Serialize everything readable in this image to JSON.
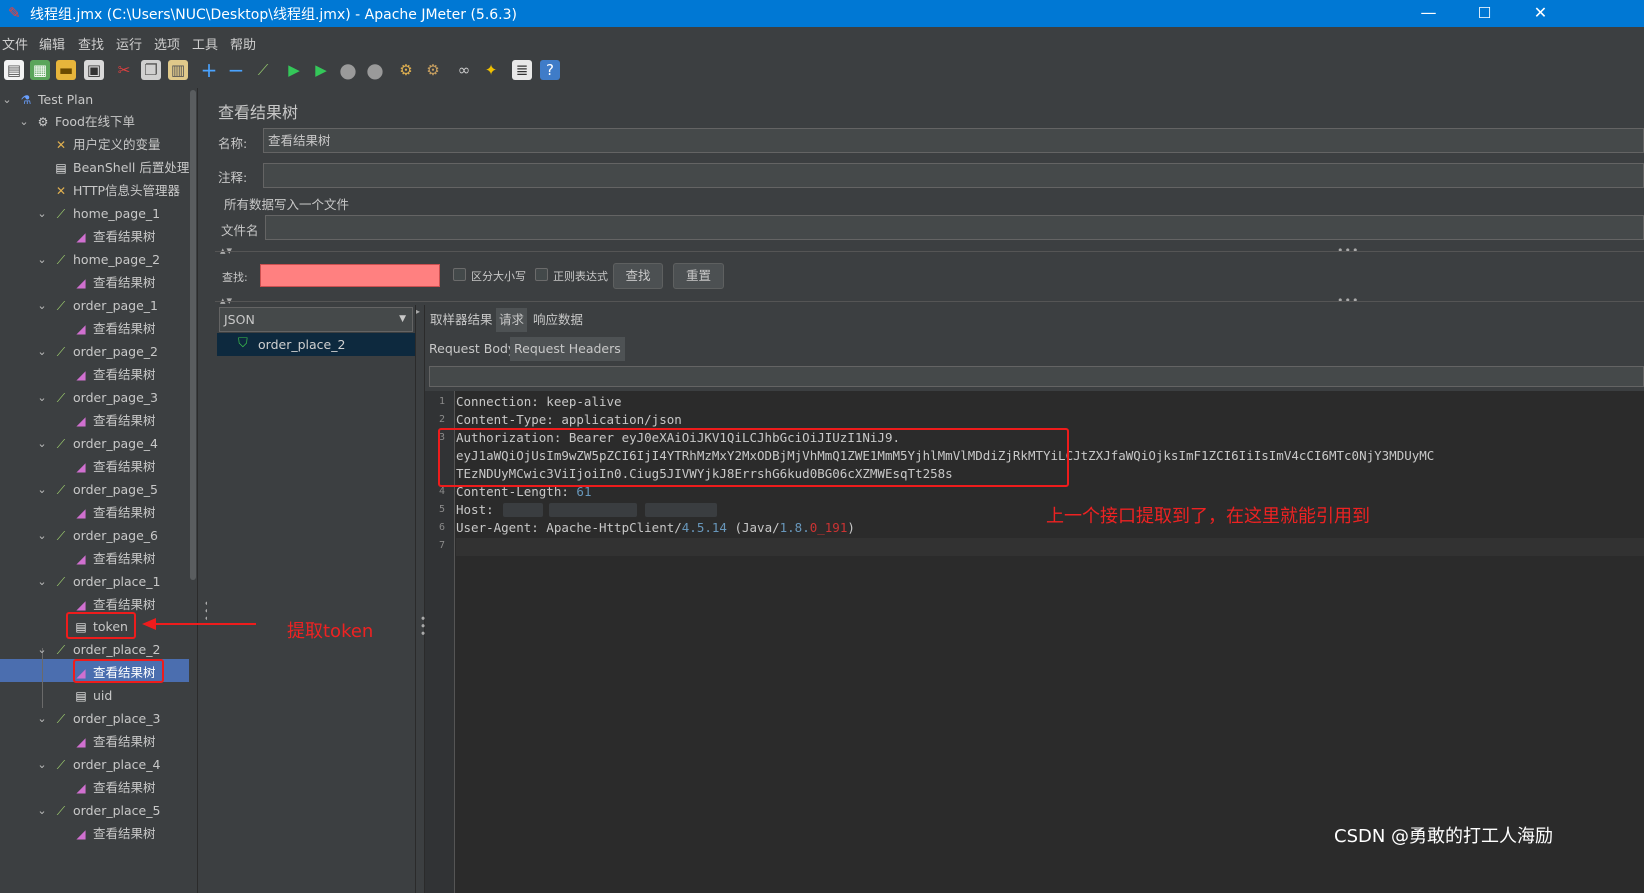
{
  "window": {
    "title": "线程组.jmx (C:\\Users\\NUC\\Desktop\\线程组.jmx) - Apache JMeter (5.6.3)",
    "minimize": "—",
    "maximize": "☐",
    "close": "✕"
  },
  "menu": [
    "文件",
    "编辑",
    "查找",
    "运行",
    "选项",
    "工具",
    "帮助"
  ],
  "tree": {
    "nodes": [
      {
        "label": "Test Plan",
        "icon": "flask-icon"
      },
      {
        "label": "Food在线下单",
        "icon": "gear-icon"
      },
      {
        "label": "用户定义的变量",
        "icon": "wrench-icon"
      },
      {
        "label": "BeanShell 后置处理程",
        "icon": "script-icon"
      },
      {
        "label": "HTTP信息头管理器",
        "icon": "wrench-icon"
      },
      {
        "label": "home_page_1",
        "icon": "pipette-icon"
      },
      {
        "label": "查看结果树",
        "icon": "chart-icon"
      },
      {
        "label": "home_page_2",
        "icon": "pipette-icon"
      },
      {
        "label": "查看结果树",
        "icon": "chart-icon"
      },
      {
        "label": "order_page_1",
        "icon": "pipette-icon"
      },
      {
        "label": "查看结果树",
        "icon": "chart-icon"
      },
      {
        "label": "order_page_2",
        "icon": "pipette-icon"
      },
      {
        "label": "查看结果树",
        "icon": "chart-icon"
      },
      {
        "label": "order_page_3",
        "icon": "pipette-icon"
      },
      {
        "label": "查看结果树",
        "icon": "chart-icon"
      },
      {
        "label": "order_page_4",
        "icon": "pipette-icon"
      },
      {
        "label": "查看结果树",
        "icon": "chart-icon"
      },
      {
        "label": "order_page_5",
        "icon": "pipette-icon"
      },
      {
        "label": "查看结果树",
        "icon": "chart-icon"
      },
      {
        "label": "order_page_6",
        "icon": "pipette-icon"
      },
      {
        "label": "查看结果树",
        "icon": "chart-icon"
      },
      {
        "label": "order_place_1",
        "icon": "pipette-icon"
      },
      {
        "label": "查看结果树",
        "icon": "chart-icon"
      },
      {
        "label": "token",
        "icon": "script-icon"
      },
      {
        "label": "order_place_2",
        "icon": "pipette-icon"
      },
      {
        "label": "查看结果树",
        "icon": "chart-icon"
      },
      {
        "label": "uid",
        "icon": "script-icon"
      },
      {
        "label": "order_place_3",
        "icon": "pipette-icon"
      },
      {
        "label": "查看结果树",
        "icon": "chart-icon"
      },
      {
        "label": "order_place_4",
        "icon": "pipette-icon"
      },
      {
        "label": "查看结果树",
        "icon": "chart-icon"
      },
      {
        "label": "order_place_5",
        "icon": "pipette-icon"
      },
      {
        "label": "查看结果树",
        "icon": "chart-icon"
      }
    ],
    "selected": "查看结果树"
  },
  "panel": {
    "title": "查看结果树",
    "name_label": "名称:",
    "name_value": "查看结果树",
    "comment_label": "注释:",
    "comment_value": "",
    "file_group": "所有数据写入一个文件",
    "filename_label": "文件名",
    "filename_value": "",
    "search_label": "查找:",
    "case_sensitive": "区分大小写",
    "regex": "正则表达式",
    "find_button": "查找",
    "reset_button": "重置"
  },
  "results": {
    "renderer": "JSON",
    "items": [
      "order_place_2"
    ]
  },
  "tabs": {
    "main": [
      "取样器结果",
      "请求",
      "响应数据"
    ],
    "main_active": "请求",
    "sub": [
      "Request Body",
      "Request Headers"
    ],
    "sub_active": "Request Headers"
  },
  "editor": {
    "line_numbers": [
      "1",
      "2",
      "3",
      "4",
      "5",
      "6",
      "7"
    ],
    "line1": "Connection: keep-alive",
    "line2": "Content-Type: application/json",
    "line3a": "Authorization: Bearer eyJ0eXAiOiJKV1QiLCJhbGciOiJIUzI1NiJ9.",
    "line3b": "eyJ1aWQiOjUsIm9wZW5pZCI6IjI4YTRhMzMxY2MxODBjMjVhMmQ1ZWE1MmM5YjhlMmVlMDdiZjRkMTYiLCJtZXJfaWQiOjksImF1ZCI6IiIsImV4cCI6MTc0NjY3MDUyMC",
    "line3c": "TEzNDUyMCwic3ViIjoiIn0.Ciug5JIVWYjkJ8ErrshG6kud0BG06cXZMWEsqTt258s",
    "line4_key": "Content-Length: ",
    "line4_val": "61",
    "line5_key": "Host: ",
    "line6_key": "User-Agent: Apache-HttpClient/",
    "line6_ver": "4.5.14",
    "line6_mid": " (Java/",
    "line6_java1": "1.8.",
    "line6_java2": "0_191",
    "line6_end": ")"
  },
  "annotations": {
    "extract_token": "提取token",
    "note": "上一个接口提取到了，在这里就能引用到"
  },
  "watermark": "CSDN @勇敢的打工人海励",
  "colors": {
    "titlebar": "#0078d4",
    "background": "#3c3f41",
    "selection": "#4b6eaf",
    "search_field": "#ff8080",
    "annotation": "#ee1c1c"
  }
}
